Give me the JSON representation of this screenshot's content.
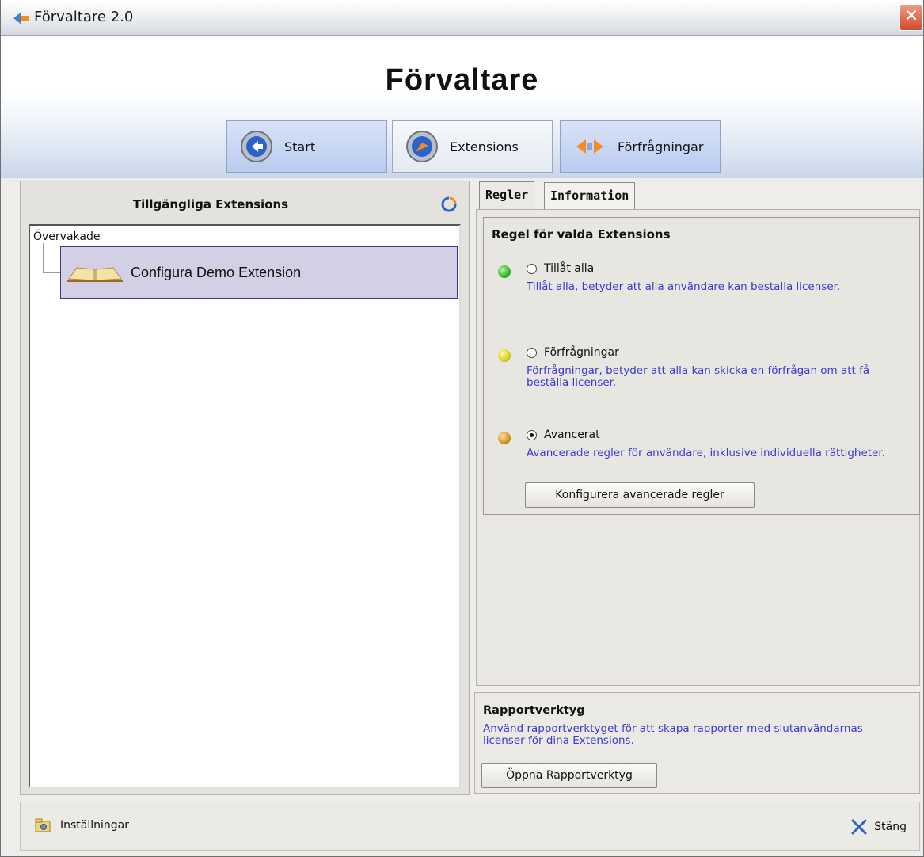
{
  "window": {
    "title": "Förvaltare 2.0",
    "close_label": "✕"
  },
  "header": {
    "app_title": "Förvaltare"
  },
  "nav": {
    "start": "Start",
    "extensions": "Extensions",
    "requests": "Förfrågningar"
  },
  "left": {
    "title": "Tillgängliga Extensions",
    "tree_root": "Övervakade",
    "tree_item": "Configura Demo Extension"
  },
  "tabs": {
    "rules": "Regler",
    "information": "Information"
  },
  "rules": {
    "title": "Regel för valda Extensions",
    "options": [
      {
        "label": "Tillåt alla",
        "desc": "Tillåt alla, betyder att alla användare kan bestalla licenser.",
        "color": "#2fb52a",
        "checked": false
      },
      {
        "label": "Förfrågningar",
        "desc": "Förfrågningar, betyder att alla kan skicka en förfrågan om att få beställa licenser.",
        "color": "#d9d21a",
        "checked": false
      },
      {
        "label": "Avancerat",
        "desc": "Avancerade regler för användare, inklusive individuella rättigheter.",
        "color": "#d6951d",
        "checked": true
      }
    ],
    "config_button": "Konfigurera avancerade regler"
  },
  "report": {
    "title": "Rapportverktyg",
    "desc": "Använd rapportverktyget för att skapa rapporter med slutanvändarnas licenser för dina Extensions.",
    "button": "Öppna Rapportverktyg"
  },
  "footer": {
    "settings": "Inställningar",
    "close": "Stäng"
  }
}
